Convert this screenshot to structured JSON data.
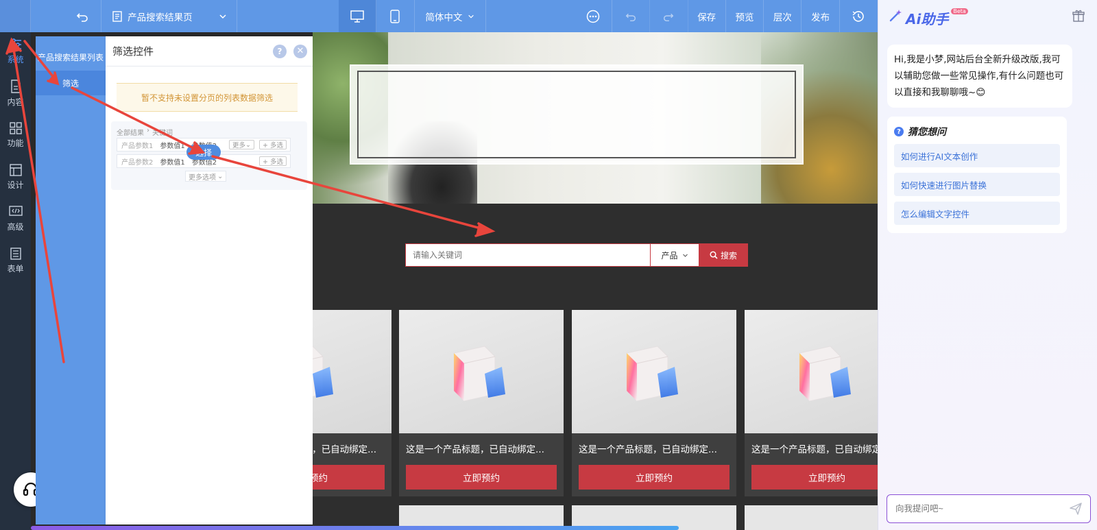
{
  "topbar": {
    "page_name": "产品搜索结果页",
    "language": "简体中文",
    "save": "保存",
    "preview": "预览",
    "layers": "层次",
    "publish": "发布"
  },
  "leftnav": {
    "items": [
      {
        "label": "系统",
        "icon": "sliders-icon"
      },
      {
        "label": "内容",
        "icon": "document-icon"
      },
      {
        "label": "功能",
        "icon": "grid-icon"
      },
      {
        "label": "设计",
        "icon": "layout-icon"
      },
      {
        "label": "高级",
        "icon": "code-icon"
      },
      {
        "label": "表单",
        "icon": "form-icon"
      }
    ]
  },
  "subpanel": {
    "items": [
      "产品搜索结果列表",
      "筛选"
    ]
  },
  "props": {
    "title": "筛选控件",
    "notice": "暂不支持未设置分页的列表数据筛选",
    "demo": {
      "all_results": "全部结果",
      "keyword": "关键词",
      "param1": "产品参数1",
      "param2": "产品参数2",
      "value1": "参数值1",
      "value2": "参数值2",
      "more": "更多",
      "multi": "+ 多选",
      "more_options": "更多选项",
      "select_button": "选择"
    }
  },
  "canvas": {
    "search_placeholder": "请输入关键词",
    "search_category": "产品",
    "search_button": "搜索",
    "cards": [
      {
        "title": "这是一个产品标题，已自动绑定...",
        "button": "立即预约"
      },
      {
        "title": "这是一个产品标题，已自动绑定...",
        "button": "立即预约"
      },
      {
        "title": "这是一个产品标题，已自动绑定...",
        "button": "立即预约"
      },
      {
        "title": "这是一个产品标题，已自动绑定...",
        "button": "立即预约"
      }
    ]
  },
  "assistant": {
    "brand": "Ai助手",
    "badge": "Beta",
    "greeting": "Hi,我是小梦,网站后台全新升级改版,我可以辅助您做一些常见操作,有什么问题也可以直接和我聊聊哦~😊",
    "guess_title": "猜您想问",
    "suggestions": [
      "如何进行AI文本创作",
      "如何快速进行图片替换",
      "怎么编辑文字控件"
    ],
    "input_placeholder": "向我提问吧~"
  }
}
